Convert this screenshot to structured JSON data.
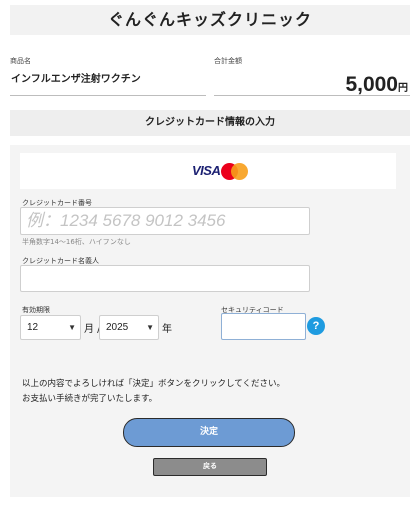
{
  "header": {
    "title": "ぐんぐんキッズクリニック"
  },
  "order": {
    "product_label": "商品名",
    "product_name": "インフルエンザ注射ワクチン",
    "amount_label": "合計金額",
    "amount_value": "5,000",
    "amount_unit": "円"
  },
  "section": {
    "title": "クレジットカード情報の入力"
  },
  "brands": {
    "visa": "VISA",
    "mastercard_icon": "mastercard-logo"
  },
  "form": {
    "card_number_label": "クレジットカード番号",
    "card_number_placeholder": "例：1234 5678 9012 3456",
    "card_number_hint": "半角数字14～16桁、ハイフンなし",
    "card_name_label": "クレジットカード名義人",
    "expiry_label": "有効期限",
    "expiry_month": "12",
    "month_unit": "月 /",
    "expiry_year": "2025",
    "year_unit": "年",
    "security_label": "セキュリティコード",
    "help_icon": "?"
  },
  "message": {
    "line1": "以上の内容でよろしければ「決定」ボタンをクリックしてください。",
    "line2": "お支払い手続きが完了いたします。"
  },
  "buttons": {
    "submit": "決定",
    "back": "戻る"
  },
  "colors": {
    "submit_bg": "#6d9bd4",
    "help_icon": "#1e9be0",
    "visa": "#1a1f71"
  }
}
